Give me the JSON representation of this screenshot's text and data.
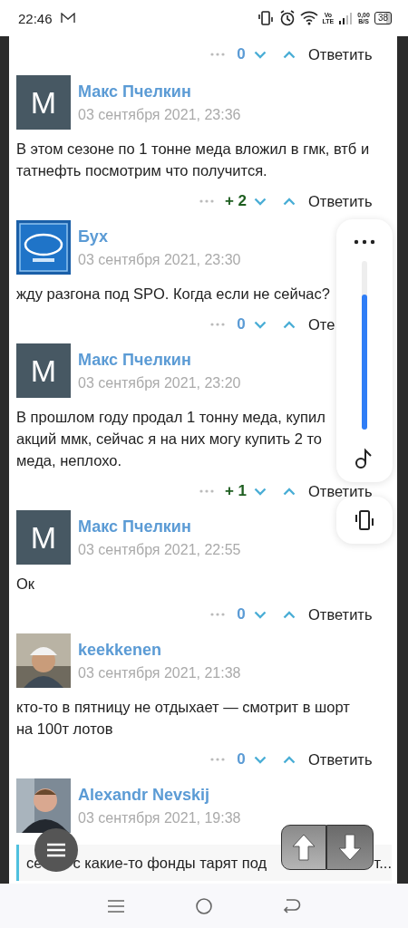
{
  "status_bar": {
    "time": "22:46",
    "network_top": "Vo",
    "network_bottom": "LTE",
    "speed_value": "0,00",
    "speed_unit": "B/S",
    "battery": "38"
  },
  "top_actions": {
    "score": "0",
    "positive": false,
    "reply": "Ответить"
  },
  "comments": [
    {
      "author": "Макс Пчелкин",
      "date": "03 сентября 2021, 23:36",
      "avatar": {
        "kind": "letter",
        "letter": "M"
      },
      "body": [
        "В этом сезоне по 1 тонне меда вложил в гмк, втб и",
        "татнефть посмотрим что получится."
      ],
      "actions": {
        "score": "+ 2",
        "positive": true,
        "reply": "Ответить"
      }
    },
    {
      "author": "Бух",
      "date": "03 сентября 2021, 23:30",
      "avatar": {
        "kind": "picture"
      },
      "body": [
        "жду разгона под SPO. Когда если не сейчас?"
      ],
      "actions": {
        "score": "0",
        "positive": false,
        "reply": "Оте"
      }
    },
    {
      "author": "Макс Пчелкин",
      "date": "03 сентября 2021, 23:20",
      "avatar": {
        "kind": "letter",
        "letter": "M"
      },
      "body": [
        "В прошлом году продал 1 тонну меда, купил",
        "акций ммк, сейчас я на них могу купить 2 то",
        "меда, неплохо."
      ],
      "actions": {
        "score": "+ 1",
        "positive": true,
        "reply": "Ответить"
      }
    },
    {
      "author": "Макс Пчелкин",
      "date": "03 сентября 2021, 22:55",
      "avatar": {
        "kind": "letter",
        "letter": "M"
      },
      "body": [
        "Ок"
      ],
      "actions": {
        "score": "0",
        "positive": false,
        "reply": "Ответить"
      }
    },
    {
      "author": "keekkenen",
      "date": "03 сентября 2021, 21:38",
      "avatar": {
        "kind": "picture"
      },
      "body": [
        "кто-то в пятницу не отдыхает — смотрит в шорт",
        "на 100т лотов"
      ],
      "actions": {
        "score": "0",
        "positive": false,
        "reply": "Ответить"
      }
    },
    {
      "author": "Alexandr Nevskij",
      "date": "03 сентября 2021, 19:38",
      "avatar": {
        "kind": "picture"
      },
      "quote": [
        "се",
        "с какие-то фонды тарят под",
        "т..."
      ]
    }
  ],
  "volume_panel": {
    "level": 0.8
  }
}
